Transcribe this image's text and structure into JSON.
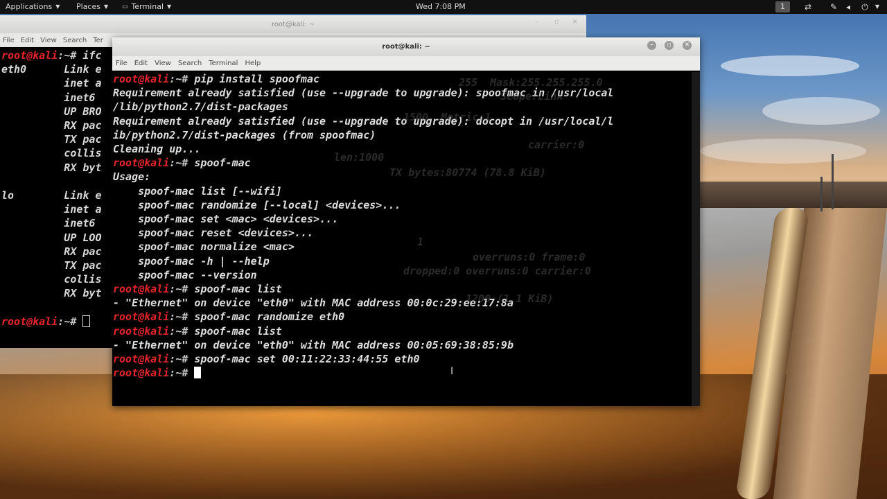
{
  "topbar": {
    "applications": "Applications",
    "places": "Places",
    "terminal": "Terminal",
    "clock": "Wed  7:08 PM",
    "workspace": "1",
    "icons": [
      "network-icon",
      "pen-icon",
      "volume-icon",
      "power-icon"
    ]
  },
  "back_window": {
    "title": "root@kali: ~",
    "menu": [
      "File",
      "Edit",
      "View",
      "Search",
      "Ter"
    ],
    "lines": [
      {
        "user": "root@kali",
        "path": ":~# ",
        "text": "ifc"
      },
      {
        "text": "eth0      Link e"
      },
      {
        "text": "          inet a"
      },
      {
        "text": "          inet6"
      },
      {
        "text": "          UP BRO"
      },
      {
        "text": "          RX pac"
      },
      {
        "text": "          TX pac"
      },
      {
        "text": "          collis"
      },
      {
        "text": "          RX byt"
      },
      {
        "text": ""
      },
      {
        "text": "lo        Link e"
      },
      {
        "text": "          inet a"
      },
      {
        "text": "          inet6"
      },
      {
        "text": "          UP LOO"
      },
      {
        "text": "          RX pac"
      },
      {
        "text": "          TX pac"
      },
      {
        "text": "          collis"
      },
      {
        "text": "          RX byt"
      },
      {
        "text": ""
      }
    ],
    "last_prompt": {
      "user": "root@kali",
      "path": ":~# "
    }
  },
  "front_window": {
    "title": "root@kali: ~",
    "menu": [
      "File",
      "Edit",
      "View",
      "Search",
      "Terminal",
      "Help"
    ],
    "lines": [
      {
        "user": "root@kali",
        "path": ":~# ",
        "text": "pip install spoofmac"
      },
      {
        "text": "Requirement already satisfied (use --upgrade to upgrade): spoofmac in /usr/local"
      },
      {
        "text": "/lib/python2.7/dist-packages"
      },
      {
        "text": "Requirement already satisfied (use --upgrade to upgrade): docopt in /usr/local/l"
      },
      {
        "text": "ib/python2.7/dist-packages (from spoofmac)"
      },
      {
        "text": "Cleaning up..."
      },
      {
        "user": "root@kali",
        "path": ":~# ",
        "text": "spoof-mac"
      },
      {
        "text": "Usage:"
      },
      {
        "text": "    spoof-mac list [--wifi]"
      },
      {
        "text": "    spoof-mac randomize [--local] <devices>..."
      },
      {
        "text": "    spoof-mac set <mac> <devices>..."
      },
      {
        "text": "    spoof-mac reset <devices>..."
      },
      {
        "text": "    spoof-mac normalize <mac>"
      },
      {
        "text": "    spoof-mac -h | --help"
      },
      {
        "text": "    spoof-mac --version"
      },
      {
        "user": "root@kali",
        "path": ":~# ",
        "text": "spoof-mac list"
      },
      {
        "text": "- \"Ethernet\" on device \"eth0\" with MAC address 00:0c:29:ee:17:8a"
      },
      {
        "user": "root@kali",
        "path": ":~# ",
        "text": "spoof-mac randomize eth0"
      },
      {
        "user": "root@kali",
        "path": ":~# ",
        "text": "spoof-mac list"
      },
      {
        "text": "- \"Ethernet\" on device \"eth0\" with MAC address 00:05:69:38:85:9b"
      },
      {
        "user": "root@kali",
        "path": ":~# ",
        "text": "spoof-mac set 00:11:22:33:44:55 eth0"
      }
    ],
    "last_prompt": {
      "user": "root@kali",
      "path": ":~# "
    }
  },
  "ghost_text": [
    "255  Mask:255.255.255.0",
    "Scope:Link",
    "1500  Metric:1",
    "carrier:0",
    "len:1000",
    "TX bytes:80774 (78.8 KiB)",
    "1",
    "overruns:0 frame:0",
    "dropped:0 overruns:0 carrier:0",
    "1200 (1.1 KiB)"
  ],
  "colors": {
    "prompt_user": "#e8242a",
    "terminal_bg": "#000000",
    "terminal_fg": "#dedede",
    "topbar_bg": "#111111"
  }
}
